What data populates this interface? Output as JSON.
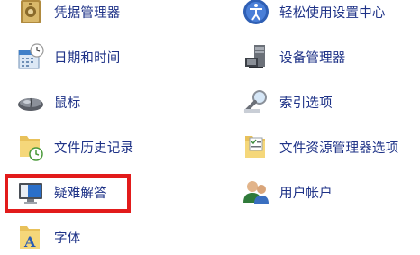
{
  "left_column": [
    {
      "label": "凭据管理器",
      "icon": "credential-manager-icon"
    },
    {
      "label": "日期和时间",
      "icon": "calendar-clock-icon"
    },
    {
      "label": "鼠标",
      "icon": "mouse-icon"
    },
    {
      "label": "文件历史记录",
      "icon": "file-history-icon"
    },
    {
      "label": "疑难解答",
      "icon": "troubleshooting-icon"
    },
    {
      "label": "字体",
      "icon": "fonts-icon"
    }
  ],
  "right_column": [
    {
      "label": "轻松使用设置中心",
      "icon": "ease-of-access-icon"
    },
    {
      "label": "设备管理器",
      "icon": "device-manager-icon"
    },
    {
      "label": "索引选项",
      "icon": "indexing-options-icon"
    },
    {
      "label": "文件资源管理器选项",
      "icon": "file-explorer-options-icon"
    },
    {
      "label": "用户帐户",
      "icon": "user-accounts-icon"
    }
  ],
  "highlight_color": "#e21b1b",
  "link_color": "#1e3287"
}
